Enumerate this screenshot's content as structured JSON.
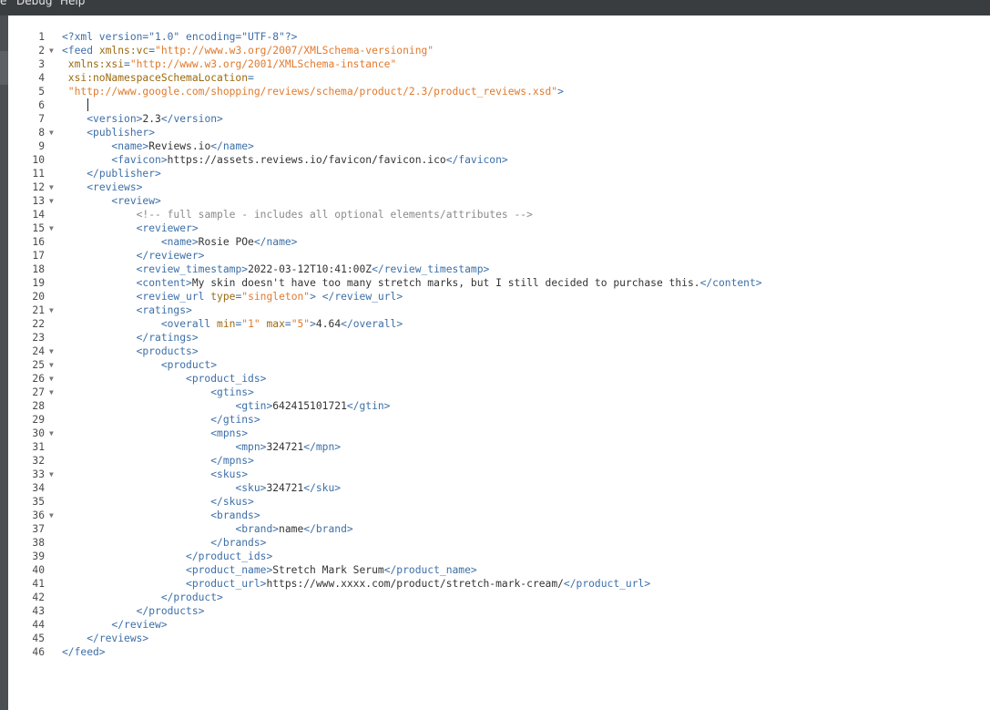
{
  "menubar": {
    "items": [
      "e",
      "Debug",
      "Help"
    ]
  },
  "editor": {
    "lines": [
      {
        "n": "1",
        "fold": false,
        "indent": 0,
        "t": [
          [
            "tag",
            "<?xml version=\"1.0\" encoding=\"UTF-8\"?>"
          ]
        ]
      },
      {
        "n": "2",
        "fold": true,
        "indent": 0,
        "t": [
          [
            "tag",
            "<feed "
          ],
          [
            "attr",
            "xmlns:vc"
          ],
          [
            "tag",
            "="
          ],
          [
            "str",
            "\"http://www.w3.org/2007/XMLSchema-versioning\""
          ]
        ]
      },
      {
        "n": "3",
        "fold": false,
        "indent": 0,
        "t": [
          [
            "attr",
            " xmlns:xsi"
          ],
          [
            "tag",
            "="
          ],
          [
            "str",
            "\"http://www.w3.org/2001/XMLSchema-instance\""
          ]
        ]
      },
      {
        "n": "4",
        "fold": false,
        "indent": 0,
        "t": [
          [
            "attr",
            " xsi:noNamespaceSchemaLocation"
          ],
          [
            "tag",
            "="
          ]
        ]
      },
      {
        "n": "5",
        "fold": false,
        "indent": 0,
        "t": [
          [
            "str",
            " \"http://www.google.com/shopping/reviews/schema/product/2.3/product_reviews.xsd\""
          ],
          [
            "tag",
            ">"
          ]
        ]
      },
      {
        "n": "6",
        "fold": false,
        "indent": 0,
        "t": []
      },
      {
        "n": "7",
        "fold": false,
        "indent": 1,
        "t": [
          [
            "tag",
            "<version>"
          ],
          [
            "txt",
            "2.3"
          ],
          [
            "tag",
            "</version>"
          ]
        ]
      },
      {
        "n": "8",
        "fold": true,
        "indent": 1,
        "t": [
          [
            "tag",
            "<publisher>"
          ]
        ]
      },
      {
        "n": "9",
        "fold": false,
        "indent": 2,
        "t": [
          [
            "tag",
            "<name>"
          ],
          [
            "txt",
            "Reviews.io"
          ],
          [
            "tag",
            "</name>"
          ]
        ]
      },
      {
        "n": "10",
        "fold": false,
        "indent": 2,
        "t": [
          [
            "tag",
            "<favicon>"
          ],
          [
            "txt",
            "https://assets.reviews.io/favicon/favicon.ico"
          ],
          [
            "tag",
            "</favicon>"
          ]
        ]
      },
      {
        "n": "11",
        "fold": false,
        "indent": 1,
        "t": [
          [
            "tag",
            "</publisher>"
          ]
        ]
      },
      {
        "n": "12",
        "fold": true,
        "indent": 1,
        "t": [
          [
            "tag",
            "<reviews>"
          ]
        ]
      },
      {
        "n": "13",
        "fold": true,
        "indent": 2,
        "t": [
          [
            "tag",
            "<review>"
          ]
        ]
      },
      {
        "n": "14",
        "fold": false,
        "indent": 3,
        "t": [
          [
            "cmt",
            "<!-- full sample - includes all optional elements/attributes -->"
          ]
        ]
      },
      {
        "n": "15",
        "fold": true,
        "indent": 3,
        "t": [
          [
            "tag",
            "<reviewer>"
          ]
        ]
      },
      {
        "n": "16",
        "fold": false,
        "indent": 4,
        "t": [
          [
            "tag",
            "<name>"
          ],
          [
            "txt",
            "Rosie POe"
          ],
          [
            "tag",
            "</name>"
          ]
        ]
      },
      {
        "n": "17",
        "fold": false,
        "indent": 3,
        "t": [
          [
            "tag",
            "</reviewer>"
          ]
        ]
      },
      {
        "n": "18",
        "fold": false,
        "indent": 3,
        "t": [
          [
            "tag",
            "<review_timestamp>"
          ],
          [
            "txt",
            "2022-03-12T10:41:00Z"
          ],
          [
            "tag",
            "</review_timestamp>"
          ]
        ]
      },
      {
        "n": "19",
        "fold": false,
        "indent": 3,
        "t": [
          [
            "tag",
            "<content>"
          ],
          [
            "txt",
            "My skin doesn't have too many stretch marks, but I still decided to purchase this."
          ],
          [
            "tag",
            "</content>"
          ]
        ]
      },
      {
        "n": "20",
        "fold": false,
        "indent": 3,
        "t": [
          [
            "tag",
            "<review_url "
          ],
          [
            "attr",
            "type"
          ],
          [
            "tag",
            "="
          ],
          [
            "str",
            "\"singleton\""
          ],
          [
            "tag",
            "> </review_url>"
          ]
        ]
      },
      {
        "n": "21",
        "fold": true,
        "indent": 3,
        "t": [
          [
            "tag",
            "<ratings>"
          ]
        ]
      },
      {
        "n": "22",
        "fold": false,
        "indent": 4,
        "t": [
          [
            "tag",
            "<overall "
          ],
          [
            "attr",
            "min"
          ],
          [
            "tag",
            "="
          ],
          [
            "str",
            "\"1\""
          ],
          [
            "attr",
            " max"
          ],
          [
            "tag",
            "="
          ],
          [
            "str",
            "\"5\""
          ],
          [
            "tag",
            ">"
          ],
          [
            "txt",
            "4.64"
          ],
          [
            "tag",
            "</overall>"
          ]
        ]
      },
      {
        "n": "23",
        "fold": false,
        "indent": 3,
        "t": [
          [
            "tag",
            "</ratings>"
          ]
        ]
      },
      {
        "n": "24",
        "fold": true,
        "indent": 3,
        "t": [
          [
            "tag",
            "<products>"
          ]
        ]
      },
      {
        "n": "25",
        "fold": true,
        "indent": 4,
        "t": [
          [
            "tag",
            "<product>"
          ]
        ]
      },
      {
        "n": "26",
        "fold": true,
        "indent": 5,
        "t": [
          [
            "tag",
            "<product_ids>"
          ]
        ]
      },
      {
        "n": "27",
        "fold": true,
        "indent": 6,
        "t": [
          [
            "tag",
            "<gtins>"
          ]
        ]
      },
      {
        "n": "28",
        "fold": false,
        "indent": 7,
        "t": [
          [
            "tag",
            "<gtin>"
          ],
          [
            "txt",
            "642415101721"
          ],
          [
            "tag",
            "</gtin>"
          ]
        ]
      },
      {
        "n": "29",
        "fold": false,
        "indent": 6,
        "t": [
          [
            "tag",
            "</gtins>"
          ]
        ]
      },
      {
        "n": "30",
        "fold": true,
        "indent": 6,
        "t": [
          [
            "tag",
            "<mpns>"
          ]
        ]
      },
      {
        "n": "31",
        "fold": false,
        "indent": 7,
        "t": [
          [
            "tag",
            "<mpn>"
          ],
          [
            "txt",
            "324721"
          ],
          [
            "tag",
            "</mpn>"
          ]
        ]
      },
      {
        "n": "32",
        "fold": false,
        "indent": 6,
        "t": [
          [
            "tag",
            "</mpns>"
          ]
        ]
      },
      {
        "n": "33",
        "fold": true,
        "indent": 6,
        "t": [
          [
            "tag",
            "<skus>"
          ]
        ]
      },
      {
        "n": "34",
        "fold": false,
        "indent": 7,
        "t": [
          [
            "tag",
            "<sku>"
          ],
          [
            "txt",
            "324721"
          ],
          [
            "tag",
            "</sku>"
          ]
        ]
      },
      {
        "n": "35",
        "fold": false,
        "indent": 6,
        "t": [
          [
            "tag",
            "</skus>"
          ]
        ]
      },
      {
        "n": "36",
        "fold": true,
        "indent": 6,
        "t": [
          [
            "tag",
            "<brands>"
          ]
        ]
      },
      {
        "n": "37",
        "fold": false,
        "indent": 7,
        "t": [
          [
            "tag",
            "<brand>"
          ],
          [
            "txt",
            "name"
          ],
          [
            "tag",
            "</brand>"
          ]
        ]
      },
      {
        "n": "38",
        "fold": false,
        "indent": 6,
        "t": [
          [
            "tag",
            "</brands>"
          ]
        ]
      },
      {
        "n": "39",
        "fold": false,
        "indent": 5,
        "t": [
          [
            "tag",
            "</product_ids>"
          ]
        ]
      },
      {
        "n": "40",
        "fold": false,
        "indent": 5,
        "t": [
          [
            "tag",
            "<product_name>"
          ],
          [
            "txt",
            "Stretch Mark Serum"
          ],
          [
            "tag",
            "</product_name>"
          ]
        ]
      },
      {
        "n": "41",
        "fold": false,
        "indent": 5,
        "t": [
          [
            "tag",
            "<product_url>"
          ],
          [
            "txt",
            "https://www.xxxx.com/product/stretch-mark-cream/"
          ],
          [
            "tag",
            "</product_url>"
          ]
        ]
      },
      {
        "n": "42",
        "fold": false,
        "indent": 4,
        "t": [
          [
            "tag",
            "</product>"
          ]
        ]
      },
      {
        "n": "43",
        "fold": false,
        "indent": 3,
        "t": [
          [
            "tag",
            "</products>"
          ]
        ]
      },
      {
        "n": "44",
        "fold": false,
        "indent": 2,
        "t": [
          [
            "tag",
            "</review>"
          ]
        ]
      },
      {
        "n": "45",
        "fold": false,
        "indent": 1,
        "t": [
          [
            "tag",
            "</reviews>"
          ]
        ]
      },
      {
        "n": "46",
        "fold": false,
        "indent": 0,
        "t": [
          [
            "tag",
            "</feed>"
          ]
        ]
      }
    ]
  }
}
